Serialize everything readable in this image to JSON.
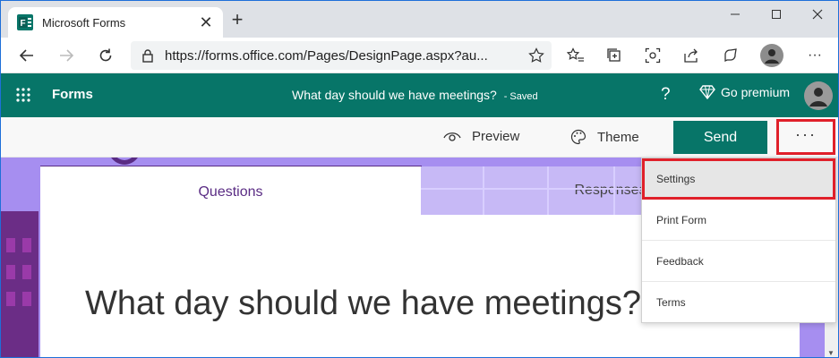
{
  "browser": {
    "tab_title": "Microsoft Forms",
    "tab_close": "✕",
    "new_tab": "+",
    "url": "https://forms.office.com/Pages/DesignPage.aspx?au...",
    "more": "···"
  },
  "appbar": {
    "app_name": "Forms",
    "doc_title": "What day should we have meetings?",
    "saved_label": "- Saved",
    "help": "?",
    "premium_label": "Go premium"
  },
  "commandbar": {
    "preview_label": "Preview",
    "theme_label": "Theme",
    "send_label": "Send",
    "more_label": "···"
  },
  "content": {
    "tabs": [
      {
        "label": "Questions"
      },
      {
        "label": "Responses"
      }
    ],
    "form_title": "What day should we have meetings?"
  },
  "menu": {
    "items": [
      {
        "label": "Settings"
      },
      {
        "label": "Print Form"
      },
      {
        "label": "Feedback"
      },
      {
        "label": "Terms"
      }
    ]
  },
  "colors": {
    "brand_teal": "#077568",
    "theme_purple": "#5a2c84",
    "highlight_red": "#e0202a",
    "background_lavender": "#a68ef0"
  },
  "icons": [
    "forms-favicon",
    "back-icon",
    "forward-icon",
    "refresh-icon",
    "lock-icon",
    "star-icon",
    "favorites-icon",
    "collections-icon",
    "screenshot-icon",
    "share-icon",
    "feedback-icon",
    "profile-avatar",
    "waffle-icon",
    "diamond-icon",
    "eye-icon",
    "palette-icon"
  ]
}
